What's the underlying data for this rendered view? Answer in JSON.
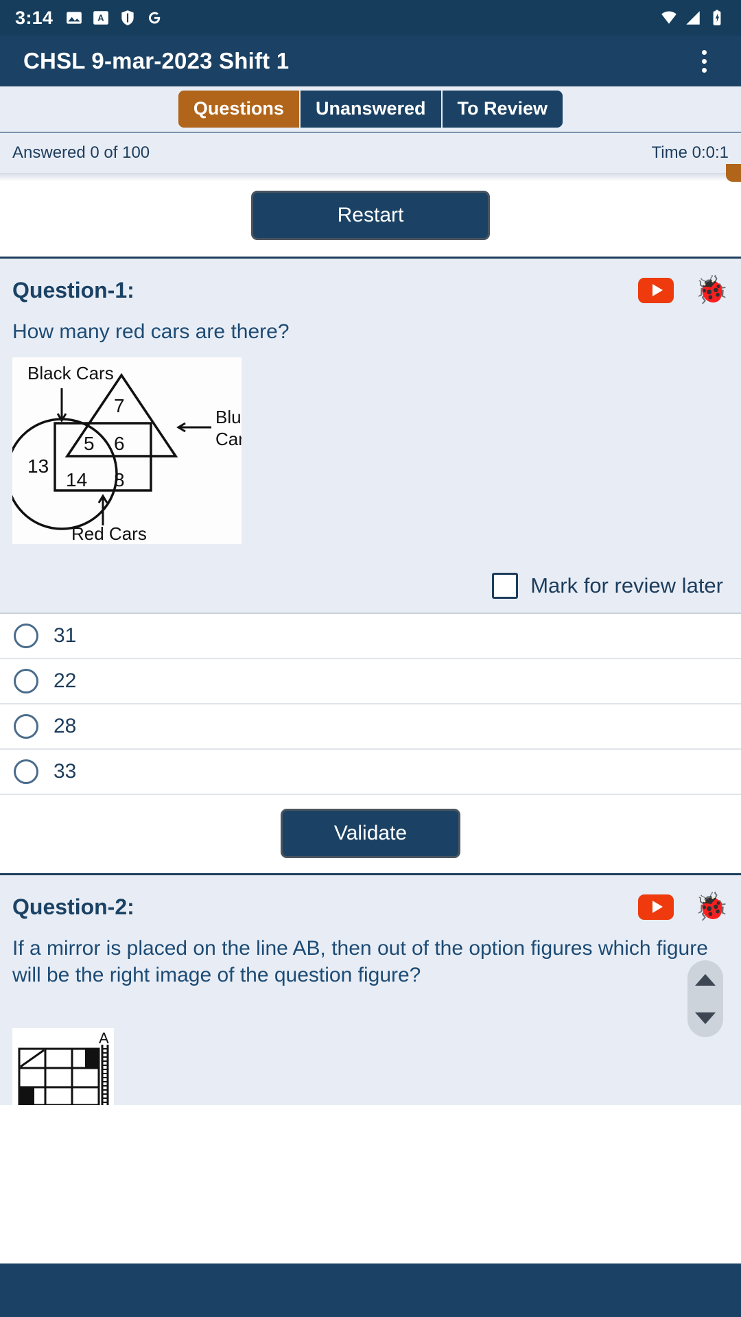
{
  "status_bar": {
    "time": "3:14",
    "left_icons": [
      "photos-icon",
      "translate-icon",
      "shield-icon",
      "google-icon"
    ],
    "right_icons": [
      "wifi-icon",
      "signal-icon",
      "battery-icon"
    ]
  },
  "app_bar": {
    "title": "CHSL 9-mar-2023 Shift 1",
    "overflow_menu": "more-options"
  },
  "tabs": [
    {
      "label": "Questions",
      "active": true
    },
    {
      "label": "Unanswered",
      "active": false
    },
    {
      "label": "To Review",
      "active": false
    }
  ],
  "meta": {
    "answered": "Answered 0 of 100",
    "time": "Time 0:0:1"
  },
  "restart": {
    "label": "Restart"
  },
  "questions": [
    {
      "title": "Question-1:",
      "text": "How many red cars are there?",
      "video_icon": "youtube-play-icon",
      "bug_icon": "bug-report-icon",
      "figure": {
        "type": "venn-diagram",
        "labels": [
          "Black Cars",
          "Blue Cars",
          "Red Cars"
        ],
        "values": [
          "7",
          "5",
          "6",
          "13",
          "14",
          "8"
        ]
      },
      "mark_label": "Mark for review later",
      "mark_checked": false,
      "options": [
        "31",
        "22",
        "28",
        "33"
      ],
      "selected": null,
      "validate_label": "Validate"
    },
    {
      "title": "Question-2:",
      "text": "If a mirror is placed on the line AB, then out of the option figures which figure will be the right image of the question figure?",
      "video_icon": "youtube-play-icon",
      "bug_icon": "bug-report-icon",
      "figure": {
        "type": "mirror-grid",
        "label": "A"
      }
    }
  ],
  "scroll": {
    "up": "scroll-up",
    "down": "scroll-down"
  },
  "colors": {
    "navy": "#1B4264",
    "orange": "#B0651B",
    "panel": "#E8EDF5",
    "youtube_red": "#EE3A0C"
  }
}
